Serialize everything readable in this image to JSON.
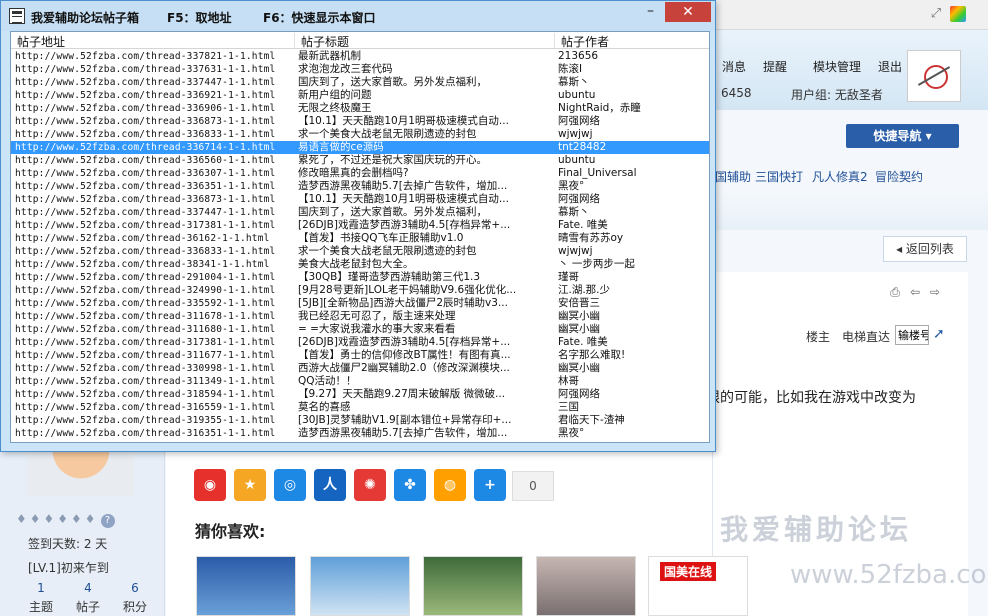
{
  "tool_window": {
    "title": "我爱辅助论坛帖子箱",
    "hotkey_fetch": "F5：取地址",
    "hotkey_show": "F6：快速显示本窗口",
    "minimize_glyph": "–",
    "close_glyph": "✕"
  },
  "list": {
    "columns": [
      "帖子地址",
      "帖子标题",
      "帖子作者"
    ],
    "selected_index": 7,
    "rows": [
      {
        "url": "http://www.52fzba.com/thread-337821-1-1.html",
        "title": "最新武器机制",
        "author": "213656"
      },
      {
        "url": "http://www.52fzba.com/thread-337631-1-1.html",
        "title": "求泡泡龙改三套代码",
        "author": "陈滚I"
      },
      {
        "url": "http://www.52fzba.com/thread-337447-1-1.html",
        "title": "国庆到了，送大家首歌。另外发点福利，",
        "author": "慕斯丶"
      },
      {
        "url": "http://www.52fzba.com/thread-336921-1-1.html",
        "title": "新用户组的问题",
        "author": "ubuntu"
      },
      {
        "url": "http://www.52fzba.com/thread-336906-1-1.html",
        "title": "无限之终极魔王",
        "author": "NightRaid，赤瞳"
      },
      {
        "url": "http://www.52fzba.com/thread-336873-1-1.html",
        "title": "【10.1】天天酷跑10月1明哥极速模式自动...",
        "author": "阿强网络"
      },
      {
        "url": "http://www.52fzba.com/thread-336833-1-1.html",
        "title": "求一个美食大战老鼠无限刷遗迹的封包",
        "author": "wjwjwj"
      },
      {
        "url": "http://www.52fzba.com/thread-336714-1-1.html",
        "title": "易语言做的ce源码",
        "author": "tnt28482"
      },
      {
        "url": "http://www.52fzba.com/thread-336560-1-1.html",
        "title": "累死了，不过还是祝大家国庆玩的开心。",
        "author": "ubuntu"
      },
      {
        "url": "http://www.52fzba.com/thread-336307-1-1.html",
        "title": "修改暗黑真的会删档吗?",
        "author": "Final_Universal"
      },
      {
        "url": "http://www.52fzba.com/thread-336351-1-1.html",
        "title": "造梦西游黑夜辅助5.7[去掉广告软件，增加...",
        "author": "黑夜°"
      },
      {
        "url": "http://www.52fzba.com/thread-336873-1-1.html",
        "title": "【10.1】天天酷跑10月1明哥极速模式自动...",
        "author": "阿强网络"
      },
      {
        "url": "http://www.52fzba.com/thread-337447-1-1.html",
        "title": "国庆到了，送大家首歌。另外发点福利，",
        "author": "慕斯丶"
      },
      {
        "url": "http://www.52fzba.com/thread-317381-1-1.html",
        "title": "[26DJB]戏霞造梦西游3辅助4.5[存档异常+...",
        "author": "Fate. 唯美"
      },
      {
        "url": "http://www.52fzba.com/thread-36162-1-1.html",
        "title": "【首发】书接QQ飞车正服辅助v1.0",
        "author": "晴雪有苏苏oy"
      },
      {
        "url": "http://www.52fzba.com/thread-336833-1-1.html",
        "title": "求一个美食大战老鼠无限刷遗迹的封包",
        "author": "wjwjwj"
      },
      {
        "url": "http://www.52fzba.com/thread-38341-1-1.html",
        "title": "美食大战老鼠封包大全。",
        "author": "丶 一步两步一起"
      },
      {
        "url": "http://www.52fzba.com/thread-291004-1-1.html",
        "title": "【30QB】瑾哥造梦西游辅助第三代1.3",
        "author": "瑾哥"
      },
      {
        "url": "http://www.52fzba.com/thread-324990-1-1.html",
        "title": "[9月28号更新]LOL老干妈辅助V9.6强化优化...",
        "author": "江.湖.那.少"
      },
      {
        "url": "http://www.52fzba.com/thread-335592-1-1.html",
        "title": "[5JB][全新物品]西游大战僵尸2辰时辅助v3...",
        "author": "安倍晋三"
      },
      {
        "url": "http://www.52fzba.com/thread-311678-1-1.html",
        "title": "我已经忍无可忍了，版主速来处理",
        "author": "幽冥小幽"
      },
      {
        "url": "http://www.52fzba.com/thread-311680-1-1.html",
        "title": "= =大家说我灌水的事大家来看看",
        "author": "幽冥小幽"
      },
      {
        "url": "http://www.52fzba.com/thread-317381-1-1.html",
        "title": "[26DJB]戏霞造梦西游3辅助4.5[存档异常+...",
        "author": "Fate. 唯美"
      },
      {
        "url": "http://www.52fzba.com/thread-311677-1-1.html",
        "title": "【首发】勇士的信仰修改BT属性！有图有真...",
        "author": "名字那么难取!"
      },
      {
        "url": "http://www.52fzba.com/thread-330998-1-1.html",
        "title": "西游大战僵尸2幽冥辅助2.0（修改深渊模块...",
        "author": "幽冥小幽"
      },
      {
        "url": "http://www.52fzba.com/thread-311349-1-1.html",
        "title": "QQ活动！！",
        "author": "林哥"
      },
      {
        "url": "http://www.52fzba.com/thread-318594-1-1.html",
        "title": "【9.27】天天酷跑9.27周末破解版 微微破...",
        "author": "阿强网络"
      },
      {
        "url": "http://www.52fzba.com/thread-316559-1-1.html",
        "title": "莫名的喜感",
        "author": "三国"
      },
      {
        "url": "http://www.52fzba.com/thread-319355-1-1.html",
        "title": "[30JB]灵梦辅助V1.9[副本错位+异常存印+...",
        "author": "君临天下-渣神"
      },
      {
        "url": "http://www.52fzba.com/thread-316351-1-1.html",
        "title": "造梦西游黑夜辅助5.7[去掉广告软件，增加...",
        "author": "黑夜°"
      }
    ]
  },
  "background_page": {
    "nav": [
      "消息",
      "提醒",
      "模块管理",
      "退出"
    ],
    "credits": "6458",
    "usergroup": "用户组: 无敌圣者",
    "quick_nav": "快捷导航 ▾",
    "subnav": [
      "国辅助",
      "三国快打",
      "凡人修真2",
      "冒险契约"
    ],
    "back_label": "◂ 返回列表",
    "floor_labels": [
      "楼主",
      "电梯直达"
    ],
    "floor_input_value": "输楼号",
    "post_text": "限的可能，比如我在游戏中改变为",
    "signin": "签到天数: 2 天",
    "level": "[LV.1]初来乍到",
    "stats": [
      {
        "num": "1",
        "label": "主题"
      },
      {
        "num": "4",
        "label": "帖子"
      },
      {
        "num": "6",
        "label": "积分"
      }
    ],
    "share_count": "0",
    "guess_title": "猜你喜欢:",
    "thumb_text": "国美在线",
    "watermark_cn": "我爱辅助论坛",
    "watermark_url": "www.52fzba.com",
    "medal_glyphs": "♦♦♦♦♦♦",
    "medal_help": "?",
    "colors": {
      "share": [
        "#e5302b",
        "#f5a623",
        "#1e88e5",
        "#1565c0",
        "#e53935",
        "#1e88e5",
        "#ffa000",
        "#1e88e5"
      ]
    }
  }
}
